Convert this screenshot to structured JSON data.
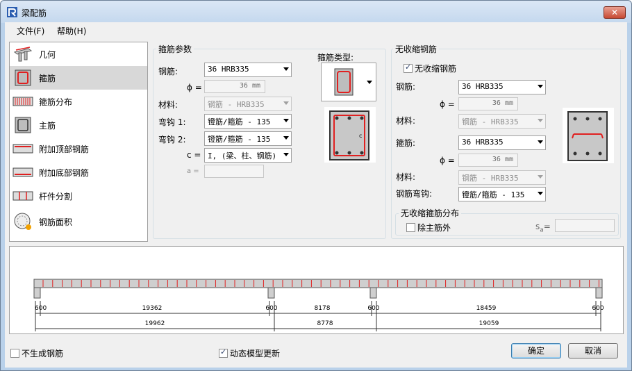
{
  "window": {
    "title": "梁配筋",
    "close_label": "✕"
  },
  "menu": [
    {
      "label": "文件(F)"
    },
    {
      "label": "帮助(H)"
    }
  ],
  "nav": [
    {
      "label": "几何",
      "icon": "geometry-icon"
    },
    {
      "label": "箍筋",
      "icon": "stirrup-icon"
    },
    {
      "label": "箍筋分布",
      "icon": "stirrup-distribution-icon"
    },
    {
      "label": "主筋",
      "icon": "main-bar-icon"
    },
    {
      "label": "附加顶部钢筋",
      "icon": "top-bar-icon"
    },
    {
      "label": "附加底部钢筋",
      "icon": "bottom-bar-icon"
    },
    {
      "label": "杆件分割",
      "icon": "segment-icon"
    },
    {
      "label": "钢筋面积",
      "icon": "bar-area-icon"
    }
  ],
  "stirrup": {
    "group_title": "箍筋参数",
    "type_label": "箍筋类型:",
    "bar_label": "钢筋:",
    "bar_value": "36 HRB335",
    "phi_label": "ϕ =",
    "phi_value": "36 mm",
    "material_label": "材料:",
    "material_value": "钢筋 - HRB335",
    "hook1_label": "弯钩 1:",
    "hook1_value": "镫筋/箍筋 - 135",
    "hook2_label": "弯钩 2:",
    "hook2_value": "镫筋/箍筋 - 135",
    "c_label": "c =",
    "c_value": "I, (梁、柱、钢筋)",
    "a_label": "a ="
  },
  "shrinkage": {
    "group_title": "无收缩钢筋",
    "checkbox_label": "无收缩钢筋",
    "bar_label": "钢筋:",
    "bar_value": "36 HRB335",
    "phi_label": "ϕ =",
    "phi_value": "36 mm",
    "material_label": "材料:",
    "material_value": "钢筋 - HRB335",
    "stirrup_label": "箍筋:",
    "stirrup_value": "36 HRB335",
    "phi2_label": "ϕ =",
    "phi2_value": "36 mm",
    "material2_label": "材料:",
    "material2_value": "钢筋 - HRB335",
    "hook_label": "钢筋弯钩:",
    "hook_value": "镫筋/箍筋 - 135",
    "dist_title": "无收缩箍筋分布",
    "except_label": "除主筋外",
    "sa_label": "s",
    "sa_sub": "a",
    "sa_eq": "="
  },
  "beam": {
    "row1": [
      "600",
      "19362",
      "600",
      "8178",
      "600",
      "18459",
      "600"
    ],
    "row2": [
      "19962",
      "8778",
      "19059"
    ]
  },
  "footer": {
    "no_generate_label": "不生成钢筋",
    "dynamic_update_label": "动态模型更新",
    "ok_label": "确定",
    "cancel_label": "取消"
  },
  "colors": {
    "rebar": "#e02020",
    "accent": "#3c7fb1"
  }
}
